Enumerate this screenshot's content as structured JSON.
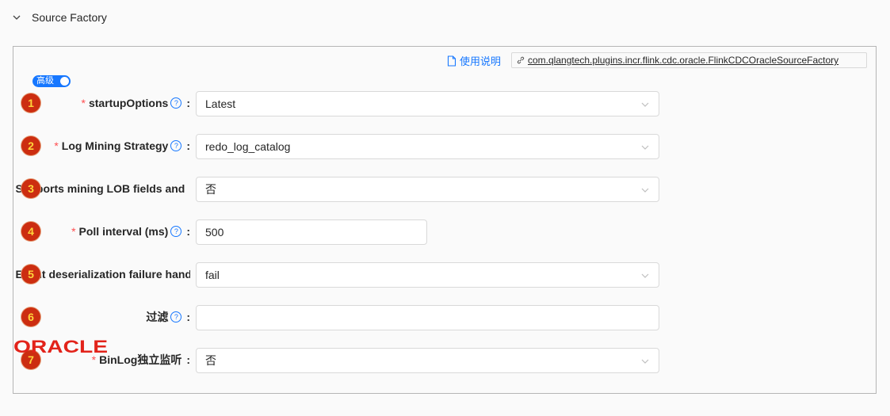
{
  "section": {
    "title": "Source Factory"
  },
  "doc_link": {
    "label": "使用说明"
  },
  "class_tag": {
    "label": " com.qlangtech.plugins.incr.flink.cdc.oracle.FlinkCDCOracleSourceFactory"
  },
  "advanced_toggle": {
    "label": "高级",
    "on": true
  },
  "help_glyph": "?",
  "colon": ":",
  "required_mark": "*",
  "fields": [
    {
      "marker": "1",
      "label": "startupOptions",
      "required": true,
      "help": true,
      "type": "select",
      "value": "Latest"
    },
    {
      "marker": "2",
      "label": "Log Mining Strategy",
      "required": true,
      "help": true,
      "type": "select",
      "value": "redo_log_catalog"
    },
    {
      "marker": "3",
      "label": "Supports mining LOB fields and",
      "required": true,
      "help": false,
      "type": "select",
      "value": "否"
    },
    {
      "marker": "4",
      "label": "Poll interval (ms)",
      "required": true,
      "help": true,
      "type": "input",
      "value": "500"
    },
    {
      "marker": "5",
      "label": "Event deserialization failure handling",
      "required": true,
      "help": false,
      "type": "select",
      "value": "fail"
    },
    {
      "marker": "6",
      "label": "过滤",
      "required": false,
      "help": true,
      "type": "input",
      "value": ""
    },
    {
      "marker": "7",
      "label": "BinLog独立监听",
      "required": true,
      "help": false,
      "type": "select",
      "value": "否"
    }
  ],
  "logo": {
    "text": "ORACLE",
    "color": "#e2231a"
  },
  "colors": {
    "accent": "#1677ff",
    "marker_bg": "#cc2d10",
    "marker_fg": "#ffd43b",
    "required": "#ff4d4f"
  }
}
